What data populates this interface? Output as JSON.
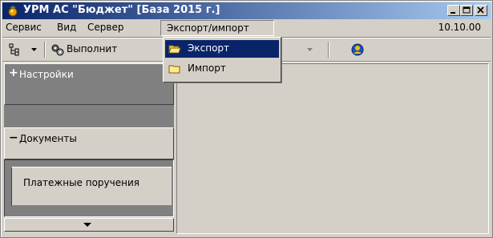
{
  "window": {
    "title": "УРМ АС \"Бюджет\" [База 2015 г.]",
    "controls": [
      "minimize",
      "maximize",
      "close"
    ]
  },
  "menubar": {
    "items": [
      "Сервис",
      "Вид",
      "Сервер",
      "Экспорт/импорт"
    ],
    "open_item": "Экспорт/импорт",
    "version": "10.10.00"
  },
  "toolbar": {
    "execute_label": "Выполнит"
  },
  "dropdown": {
    "items": [
      {
        "label": "Экспорт",
        "icon": "folder-open-icon",
        "selected": true
      },
      {
        "label": "Импорт",
        "icon": "folder-icon",
        "selected": false
      }
    ]
  },
  "left_panel": {
    "sections": [
      {
        "sign": "+",
        "label": "Настройки"
      },
      {
        "sign": "−",
        "label": "Документы"
      }
    ],
    "documents_item": "Платежные поручения"
  },
  "colors": {
    "title_start": "#0a246a",
    "title_end": "#a6caf0",
    "face": "#d4d0c8",
    "selection": "#0a246a",
    "dark_panel": "#808080"
  }
}
